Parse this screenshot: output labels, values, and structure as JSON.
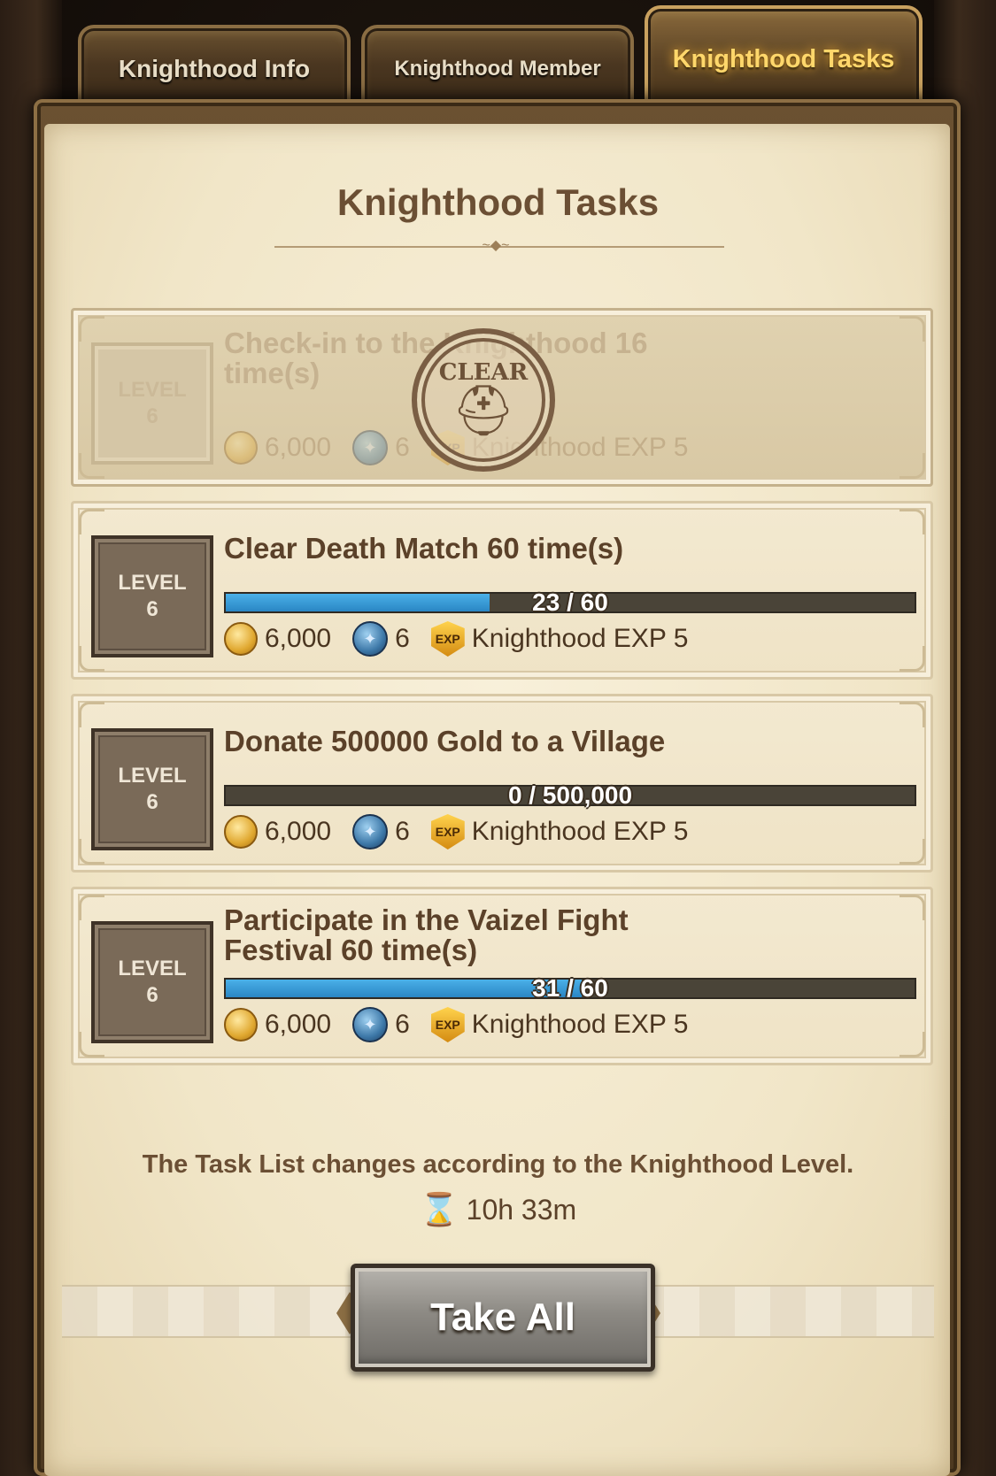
{
  "tabs": [
    {
      "label": "Knighthood Info"
    },
    {
      "label": "Knighthood Member"
    },
    {
      "label": "Knighthood Tasks"
    }
  ],
  "panel": {
    "title": "Knighthood Tasks",
    "note": "The Task List changes according to the Knighthood Level.",
    "timer": "10h 33m",
    "take_all": "Take All"
  },
  "tasks": [
    {
      "level_label": "LEVEL",
      "level": "6",
      "name": "Check-in to the Knighthood 16 time(s)",
      "completed": true,
      "stamp_text": "CLEAR",
      "gold": "6,000",
      "gem": "6",
      "exp": "Knighthood EXP 5"
    },
    {
      "level_label": "LEVEL",
      "level": "6",
      "name": "Clear Death Match 60 time(s)",
      "progress_text": "23 / 60",
      "progress": 0.383,
      "gold": "6,000",
      "gem": "6",
      "exp": "Knighthood EXP 5"
    },
    {
      "level_label": "LEVEL",
      "level": "6",
      "name": "Donate 500000 Gold to a Village",
      "progress_text": "0 / 500,000",
      "progress": 0,
      "gold": "6,000",
      "gem": "6",
      "exp": "Knighthood EXP 5"
    },
    {
      "level_label": "LEVEL",
      "level": "6",
      "name": "Participate in the Vaizel Fight Festival 60 time(s)",
      "progress_text": "31 / 60",
      "progress": 0.517,
      "gold": "6,000",
      "gem": "6",
      "exp": "Knighthood EXP 5"
    }
  ],
  "icons": {
    "gold": "gold-coin-icon",
    "gem": "crest-gem-icon",
    "exp": "exp-shield-icon",
    "timer": "hourglass-icon"
  },
  "colors": {
    "progress_fill": "#2a86c4",
    "active_tab_text": "#ffd76b"
  }
}
